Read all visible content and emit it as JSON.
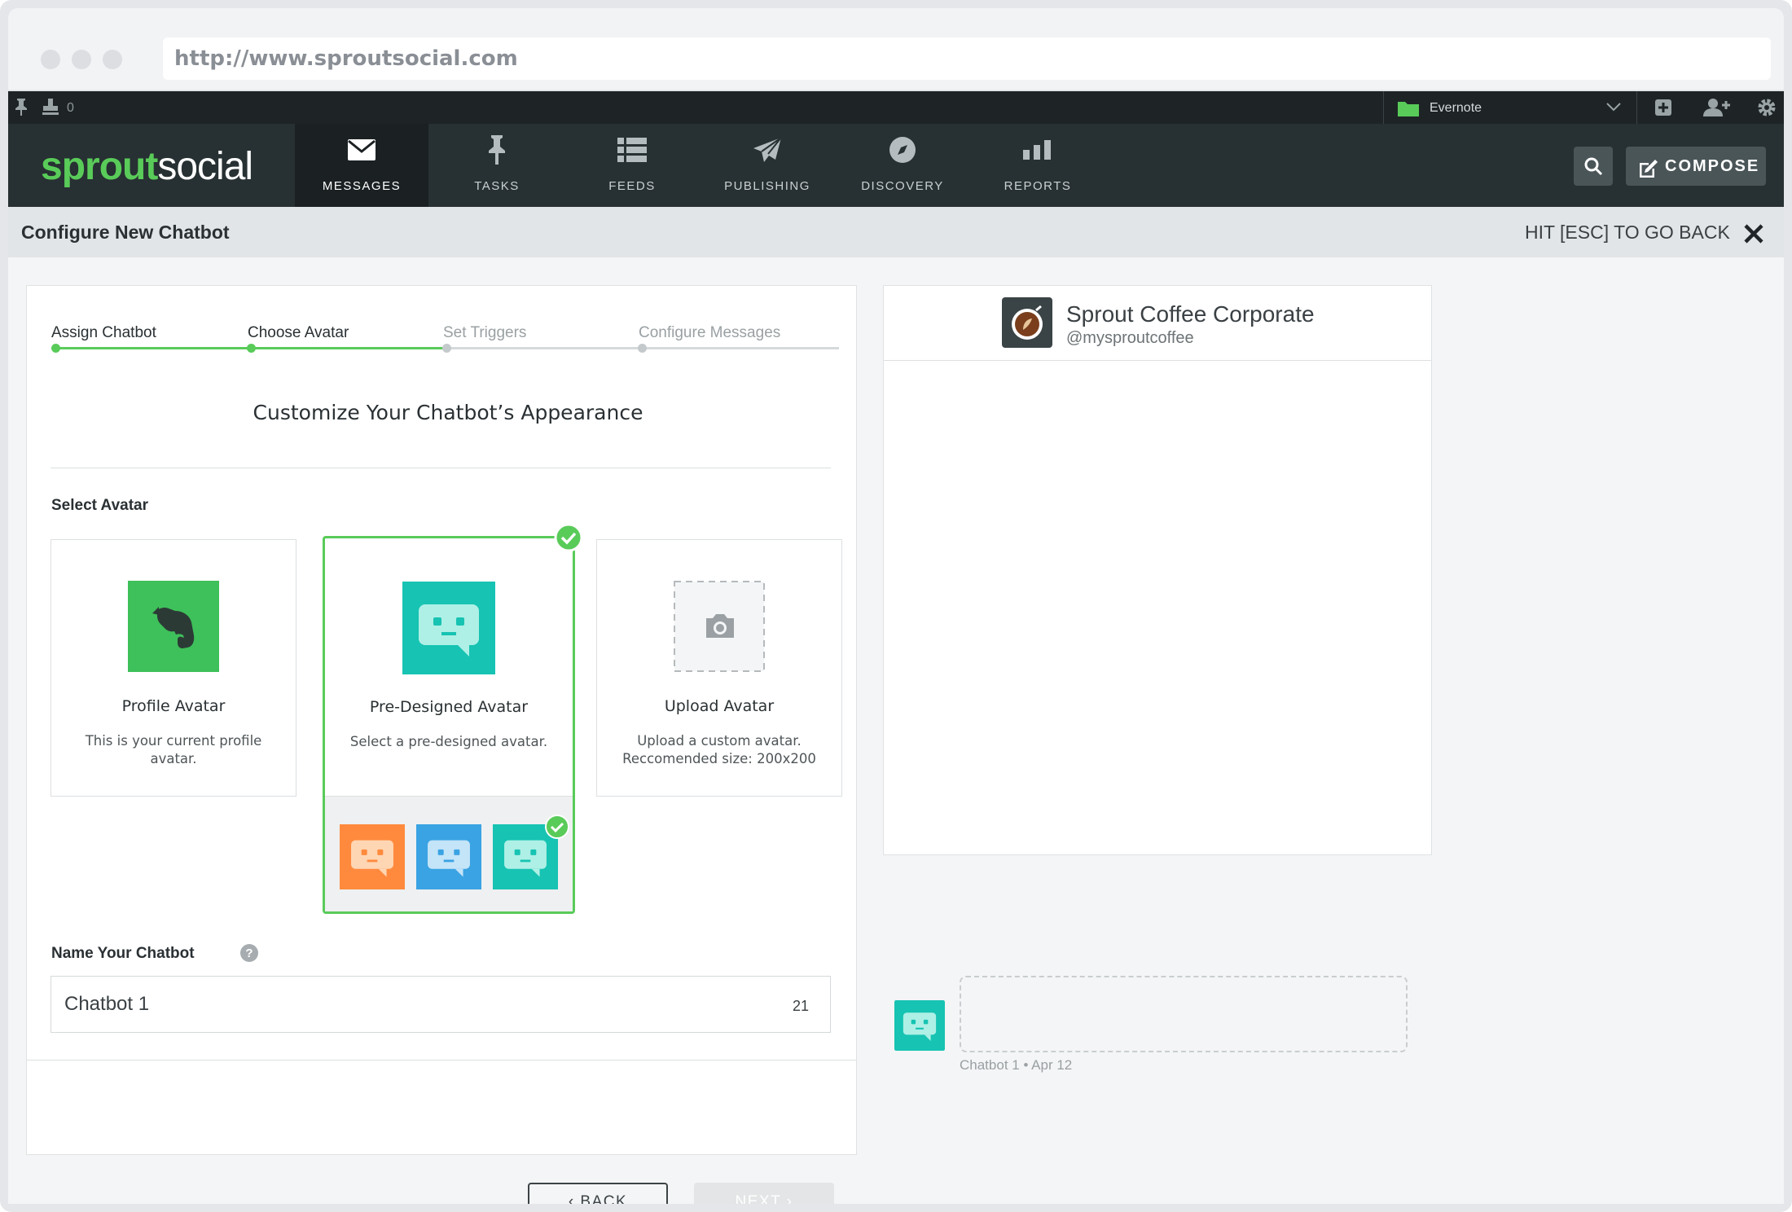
{
  "browser": {
    "url": "http://www.sproutsocial.com"
  },
  "topbar": {
    "count": "0",
    "profile_group": "Evernote"
  },
  "brand": {
    "part1": "sprout",
    "part2": "social"
  },
  "nav": {
    "items": [
      {
        "label": "MESSAGES",
        "icon": "envelope-icon",
        "active": true
      },
      {
        "label": "TASKS",
        "icon": "pin-icon"
      },
      {
        "label": "FEEDS",
        "icon": "list-icon"
      },
      {
        "label": "PUBLISHING",
        "icon": "paper-plane-icon"
      },
      {
        "label": "DISCOVERY",
        "icon": "compass-icon"
      },
      {
        "label": "REPORTS",
        "icon": "bar-chart-icon"
      }
    ],
    "compose_label": "COMPOSE"
  },
  "header": {
    "title": "Configure New Chatbot",
    "esc_label": "HIT [ESC] TO GO BACK"
  },
  "steps": [
    {
      "label": "Assign Chatbot",
      "done": true
    },
    {
      "label": "Choose Avatar",
      "done": true
    },
    {
      "label": "Set Triggers",
      "done": false
    },
    {
      "label": "Configure Messages",
      "done": false
    }
  ],
  "main": {
    "heading": "Customize Your Chatbot’s Appearance",
    "select_label": "Select Avatar",
    "options": [
      {
        "title": "Profile Avatar",
        "desc": "This is your current profile avatar."
      },
      {
        "title": "Pre-Designed Avatar",
        "desc": "Select a pre-designed avatar.",
        "selected": true
      },
      {
        "title": "Upload Avatar",
        "desc": "Upload a custom avatar. Reccomended size: 200x200"
      }
    ],
    "name_label": "Name Your Chatbot",
    "name_value": "Chatbot 1",
    "char_count": "21",
    "back_label": "‹ BACK",
    "next_label": "NEXT ›"
  },
  "preview": {
    "account_name": "Sprout Coffee Corporate",
    "handle": "@mysproutcoffee",
    "meta": "Chatbot 1 • Apr 12"
  },
  "colors": {
    "green": "#59cb59",
    "teal": "#17c3b2",
    "orange": "#ff8a3d",
    "blue": "#3aa3e3",
    "navbar": "#273032"
  }
}
